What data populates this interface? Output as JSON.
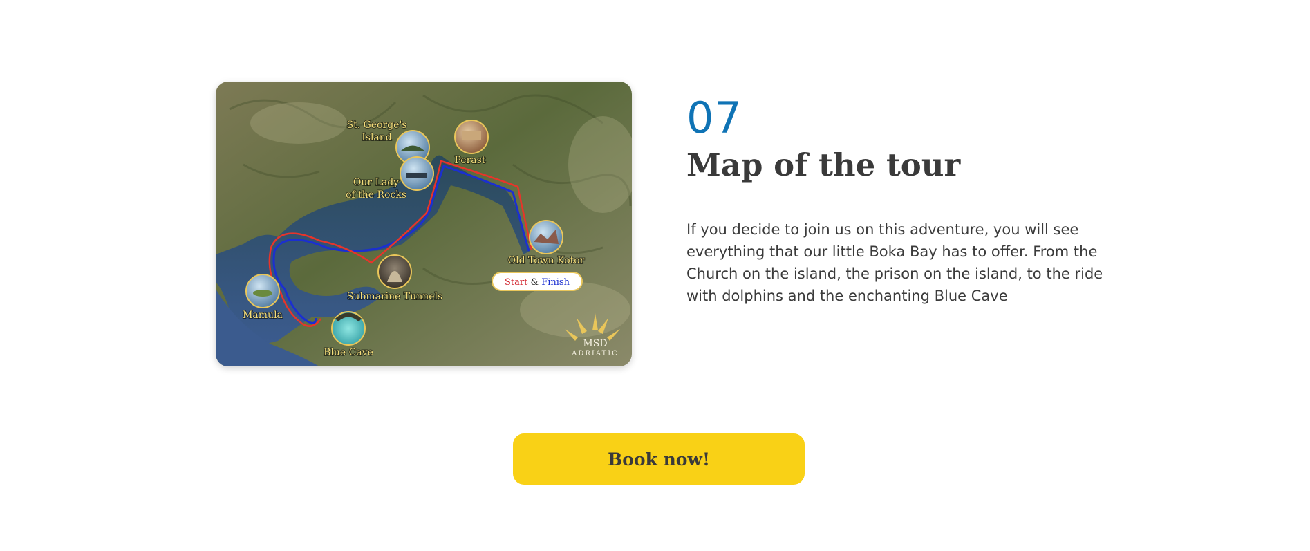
{
  "map": {
    "labels": {
      "st_george_line1": "St. George's",
      "st_george_line2": "Island",
      "perast": "Perast",
      "our_lady_line1": "Our Lady",
      "our_lady_line2": "of the Rocks",
      "old_town_kotor": "Old Town Kotor",
      "submarine_tunnels": "Submarine Tunnels",
      "mamula": "Mamula",
      "blue_cave": "Blue Cave"
    },
    "start_label": "Start",
    "amp": "&",
    "finish_label": "Finish",
    "logo_top": "MSD",
    "logo_bottom": "ADRIATIC",
    "route_colors": {
      "outbound": "#e8342a",
      "return": "#1b2fd1"
    }
  },
  "content": {
    "step_number": "07",
    "title": "Map of the tour",
    "description": "If you decide to join us on this adventure, you will see everything that our little Boka Bay has to offer. From the Church on the island, the prison on the island, to the ride with dolphins and the enchanting Blue Cave"
  },
  "cta": {
    "label": "Book now!",
    "color": "#f9d116"
  },
  "colors": {
    "accent": "#0f73b5",
    "heading": "#3a3a3a"
  }
}
